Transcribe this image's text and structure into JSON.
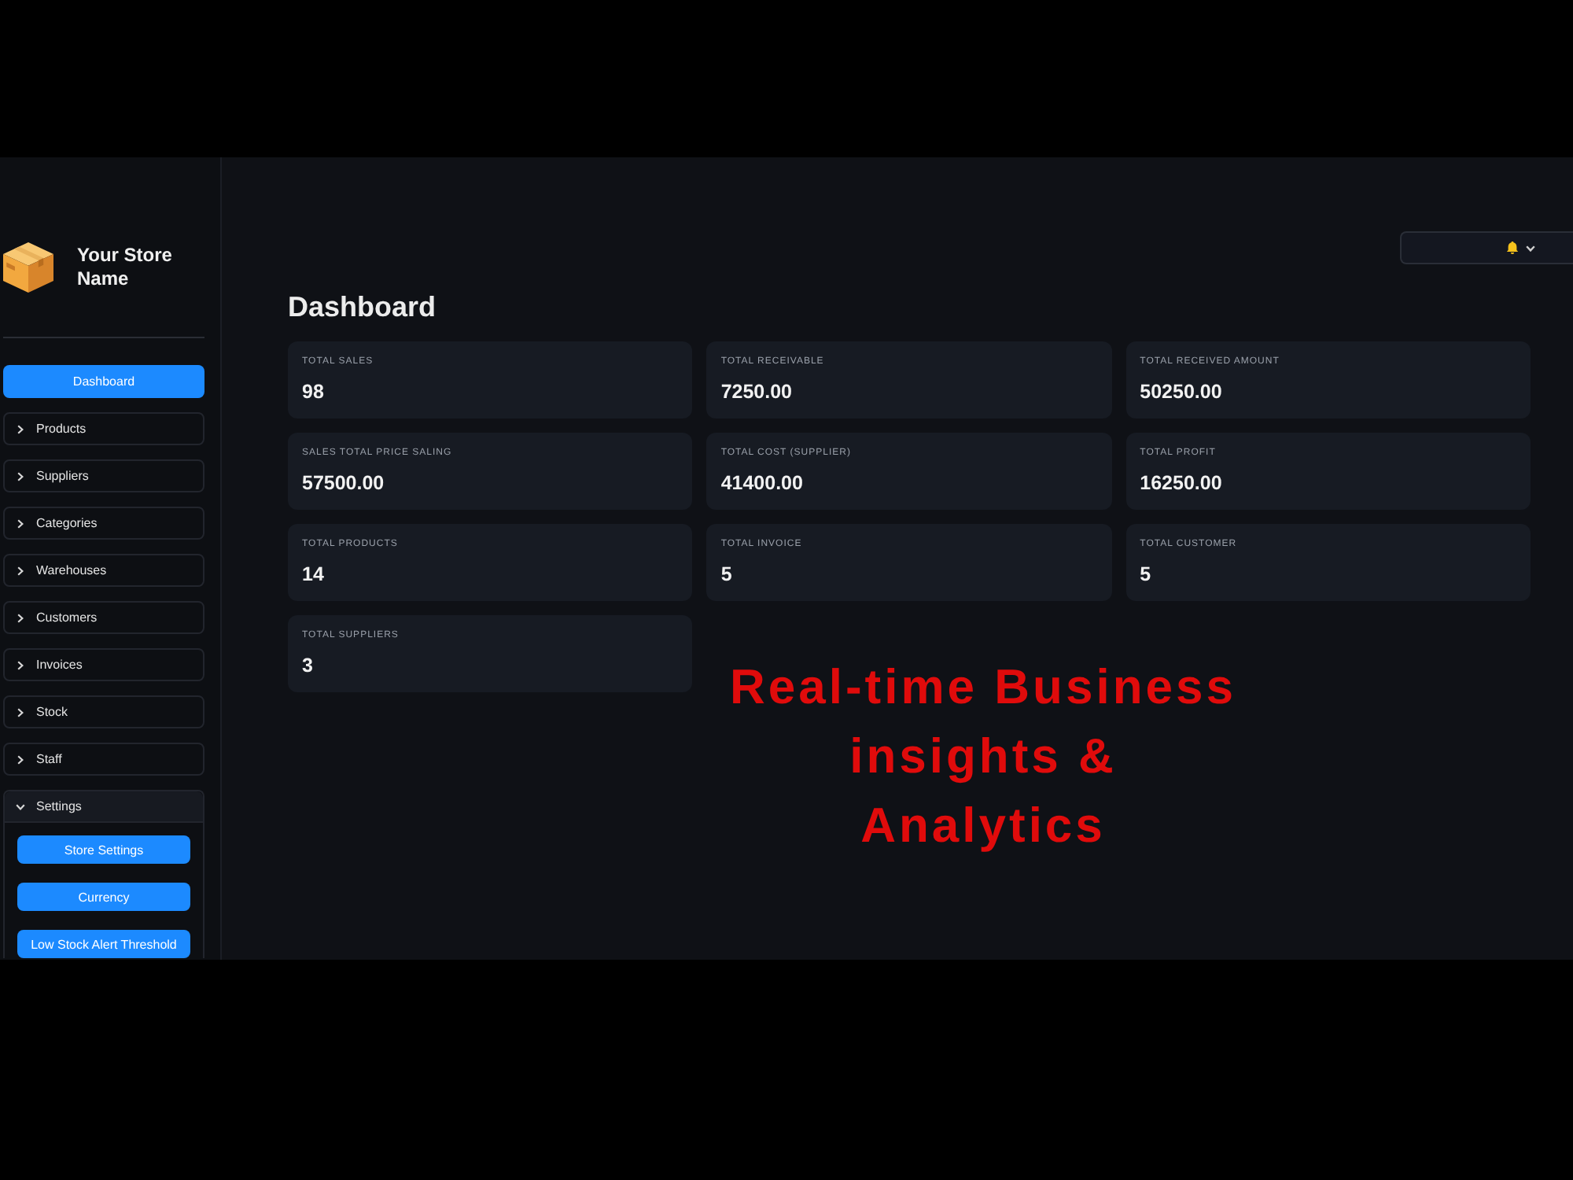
{
  "sidebar": {
    "store_name": "Your Store Name",
    "items": [
      {
        "kind": "button",
        "label": "Dashboard"
      },
      {
        "kind": "group",
        "label": "Products",
        "expanded": false
      },
      {
        "kind": "group",
        "label": "Suppliers",
        "expanded": false
      },
      {
        "kind": "group",
        "label": "Categories",
        "expanded": false
      },
      {
        "kind": "group",
        "label": "Warehouses",
        "expanded": false
      },
      {
        "kind": "group",
        "label": "Customers",
        "expanded": false
      },
      {
        "kind": "group",
        "label": "Invoices",
        "expanded": false
      },
      {
        "kind": "group",
        "label": "Stock",
        "expanded": false
      },
      {
        "kind": "group",
        "label": "Staff",
        "expanded": false
      },
      {
        "kind": "group",
        "label": "Settings",
        "expanded": true,
        "children": [
          "Store Settings",
          "Currency",
          "Low Stock Alert Threshold"
        ]
      }
    ]
  },
  "page_title": "Dashboard",
  "metrics": [
    {
      "label": "TOTAL SALES",
      "value": "98"
    },
    {
      "label": "TOTAL RECEIVABLE",
      "value": "7250.00"
    },
    {
      "label": "TOTAL RECEIVED AMOUNT",
      "value": "50250.00"
    },
    {
      "label": "SALES TOTAL PRICE SALING",
      "value": "57500.00"
    },
    {
      "label": "TOTAL COST (SUPPLIER)",
      "value": "41400.00"
    },
    {
      "label": "TOTAL PROFIT",
      "value": "16250.00"
    },
    {
      "label": "TOTAL PRODUCTS",
      "value": "14"
    },
    {
      "label": "TOTAL INVOICE",
      "value": "5"
    },
    {
      "label": "TOTAL CUSTOMER",
      "value": "5"
    },
    {
      "label": "TOTAL SUPPLIERS",
      "value": "3"
    }
  ],
  "overlay_caption": "Real-time Business insights & Analytics"
}
